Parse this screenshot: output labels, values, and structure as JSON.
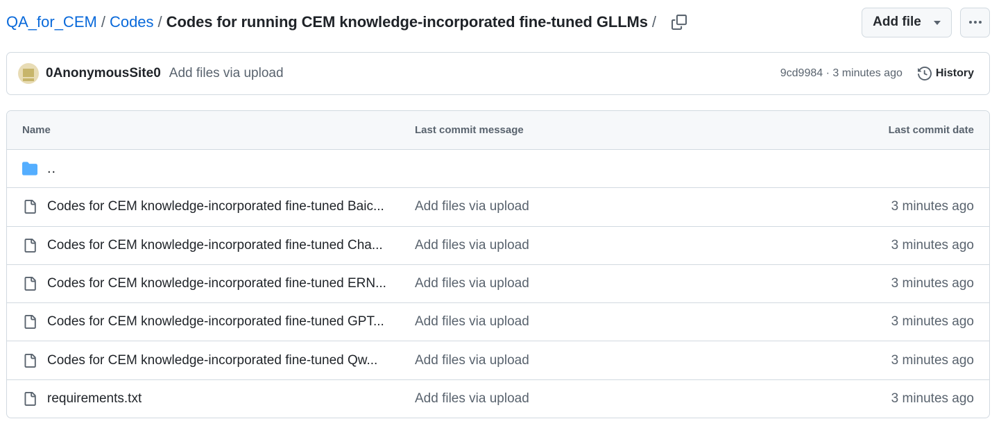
{
  "breadcrumb": {
    "repo": "QA_for_CEM",
    "sep": "/",
    "folder": "Codes",
    "current": "Codes for running CEM knowledge-incorporated fine-tuned GLLMs"
  },
  "actions": {
    "add_file_label": "Add file"
  },
  "commit": {
    "author": "0AnonymousSite0",
    "message": "Add files via upload",
    "meta": "9cd9984 · 3 minutes ago",
    "history_label": "History"
  },
  "table": {
    "headers": {
      "name": "Name",
      "message": "Last commit message",
      "date": "Last commit date"
    },
    "parent": "..",
    "rows": [
      {
        "name": "Codes for CEM knowledge-incorporated fine-tuned Baic...",
        "message": "Add files via upload",
        "date": "3 minutes ago"
      },
      {
        "name": "Codes for CEM knowledge-incorporated fine-tuned Cha...",
        "message": "Add files via upload",
        "date": "3 minutes ago"
      },
      {
        "name": "Codes for CEM knowledge-incorporated fine-tuned ERN...",
        "message": "Add files via upload",
        "date": "3 minutes ago"
      },
      {
        "name": "Codes for CEM knowledge-incorporated fine-tuned GPT...",
        "message": "Add files via upload",
        "date": "3 minutes ago"
      },
      {
        "name": "Codes for CEM knowledge-incorporated fine-tuned Qw...",
        "message": "Add files via upload",
        "date": "3 minutes ago"
      },
      {
        "name": "requirements.txt",
        "message": "Add files via upload",
        "date": "3 minutes ago"
      }
    ]
  },
  "colors": {
    "link": "#0969da",
    "folder": "#54aeff",
    "muted": "#59636e",
    "border": "#d1d9e0"
  },
  "icons": {
    "copy": "copy-icon",
    "history": "history-icon",
    "folder": "folder-icon",
    "file": "file-icon",
    "kebab": "kebab-horizontal-icon",
    "caret": "triangle-down-icon"
  }
}
